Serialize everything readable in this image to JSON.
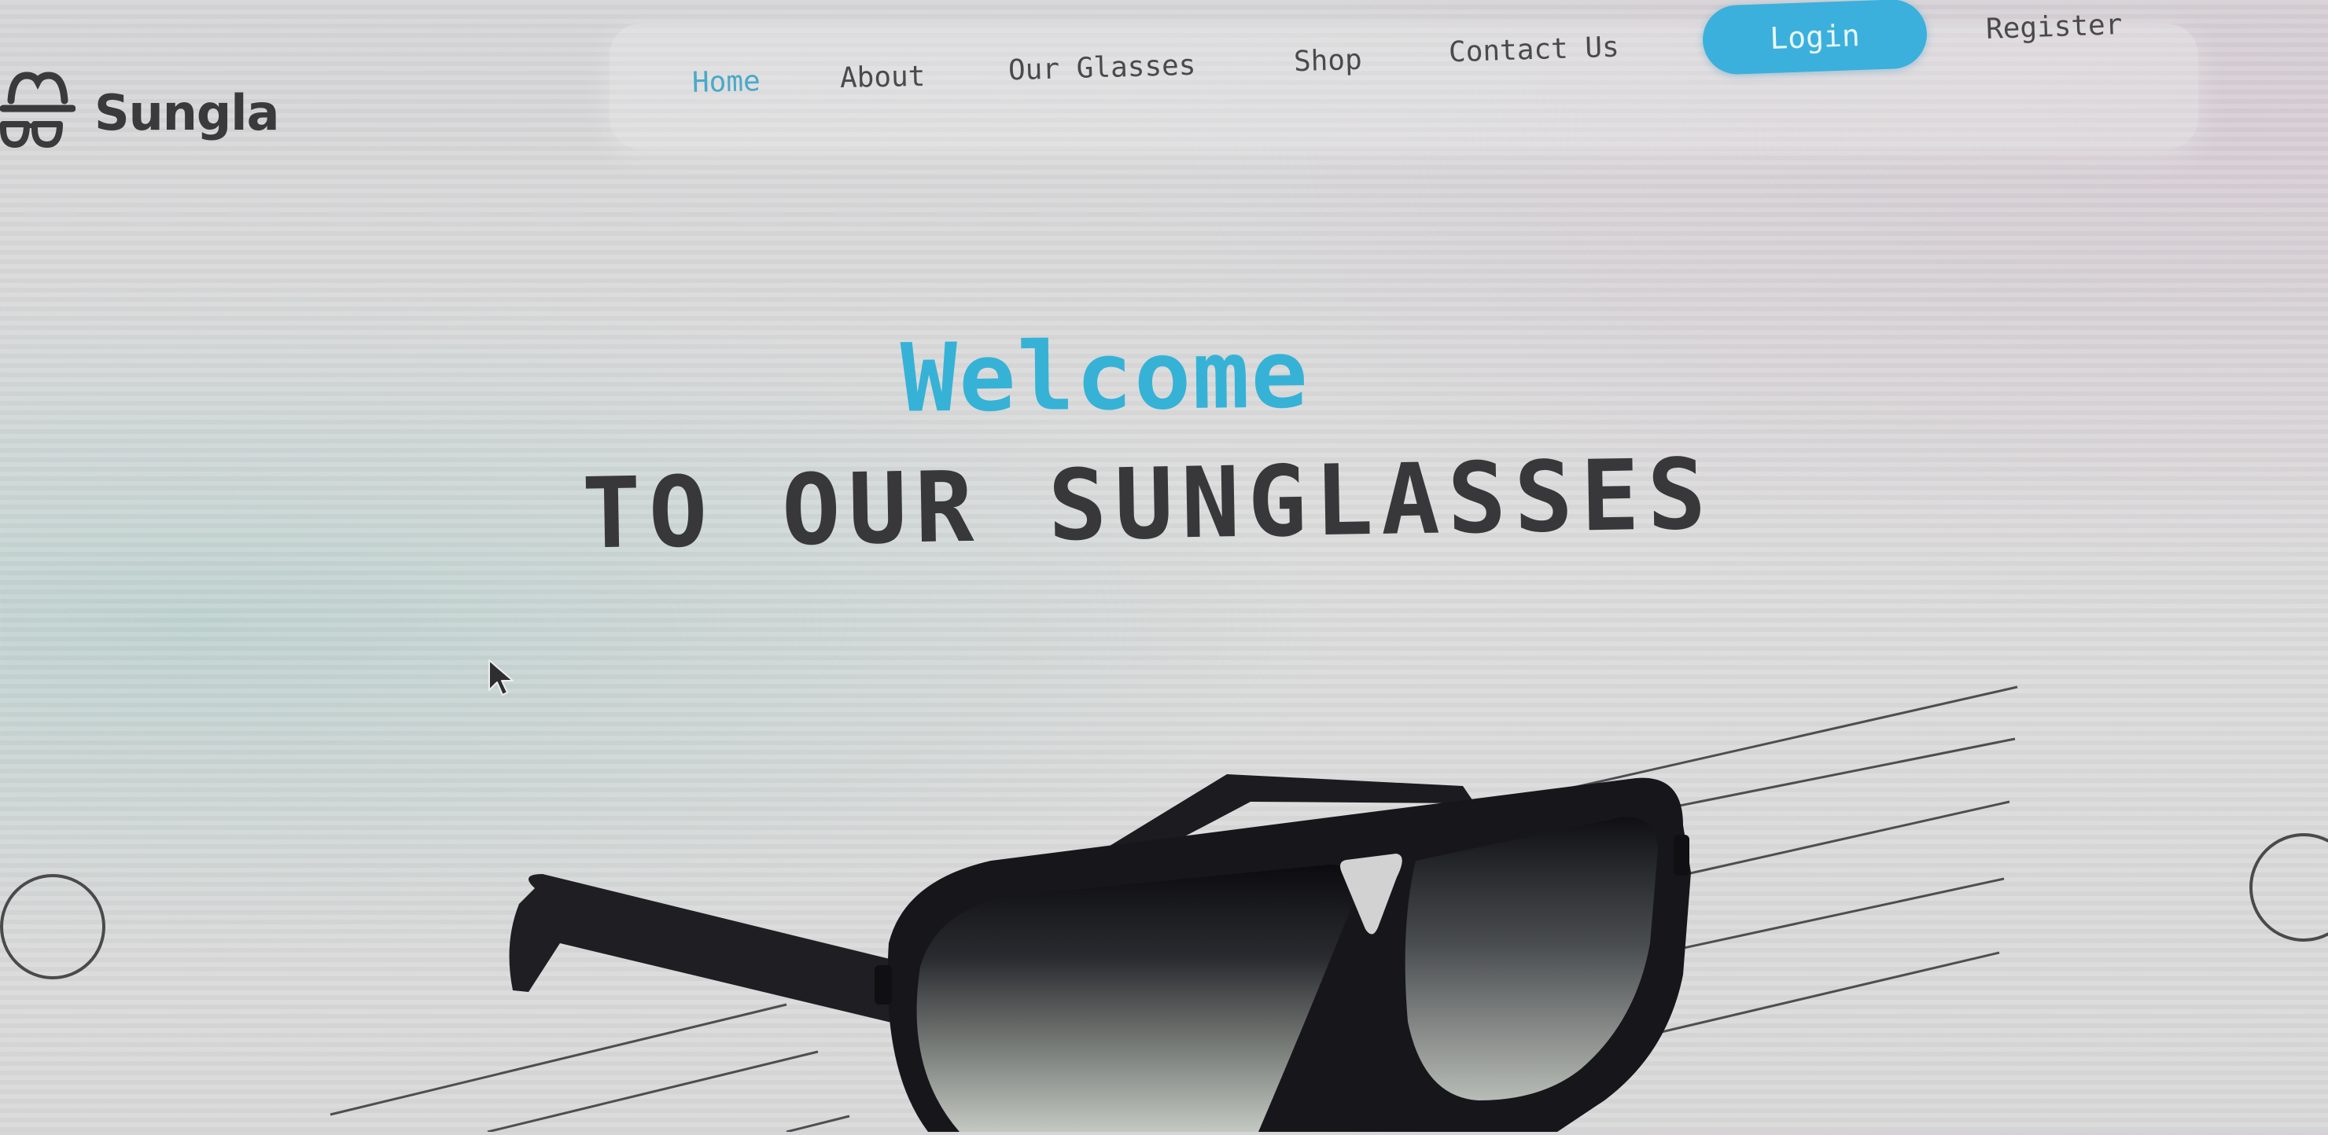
{
  "brand": {
    "name": "Sungla",
    "logo_icon": "spy-hat-glasses-icon"
  },
  "nav": {
    "items": [
      {
        "label": "Home",
        "active": true
      },
      {
        "label": "About",
        "active": false
      },
      {
        "label": "Our Glasses",
        "active": false
      },
      {
        "label": "Shop",
        "active": false
      },
      {
        "label": "Contact Us",
        "active": false
      }
    ],
    "login_label": "Login",
    "register_label": "Register"
  },
  "hero": {
    "welcome": "Welcome",
    "subtitle": "TO OUR SUNGLASSES"
  },
  "colors": {
    "accent": "#36b2d6",
    "text_dark": "#38383a",
    "nav_text": "#4a4a4c",
    "background": "#d9d9d9"
  },
  "icons": {
    "cursor": "mouse-pointer-icon",
    "carousel_prev": "circle-prev-icon",
    "carousel_next": "circle-next-icon"
  }
}
